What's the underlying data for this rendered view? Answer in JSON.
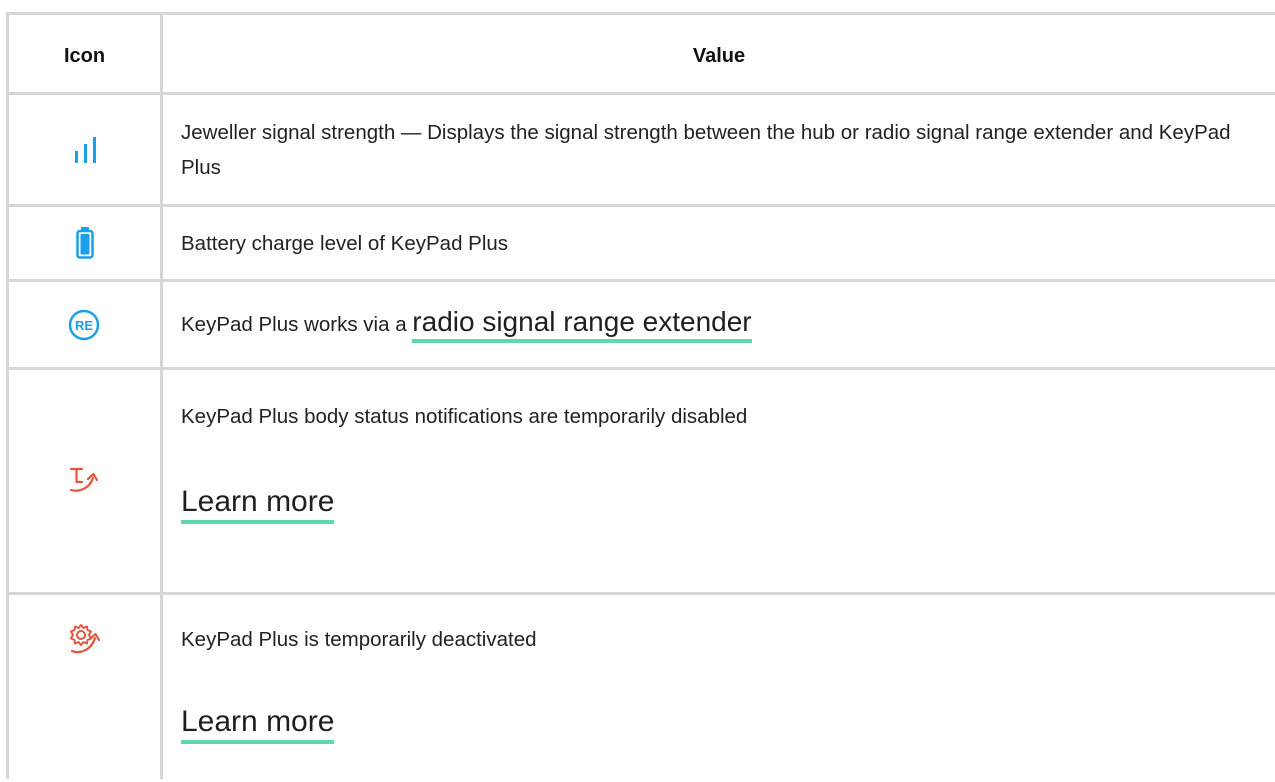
{
  "table": {
    "headers": {
      "icon": "Icon",
      "value": "Value"
    },
    "rows": [
      {
        "icon": "signal-strength-icon",
        "text": "Jeweller signal strength — Displays the signal strength between the hub or radio signal range extender and KeyPad Plus"
      },
      {
        "icon": "battery-icon",
        "text": "Battery charge level of KeyPad Plus"
      },
      {
        "icon": "range-extender-icon",
        "text": "KeyPad Plus works via a ",
        "link": "radio signal range extender"
      },
      {
        "icon": "body-notifications-disabled-icon",
        "text": "KeyPad Plus body status notifications are temporarily disabled",
        "link": "Learn more"
      },
      {
        "icon": "temporarily-deactivated-icon",
        "text": "KeyPad Plus is temporarily deactivated",
        "link": "Learn more"
      }
    ],
    "re_badge": "RE"
  },
  "colors": {
    "blue": "#1a9fe8",
    "red": "#e5553f",
    "link_underline": "#5fd9a8",
    "border": "#d6d6d6"
  }
}
